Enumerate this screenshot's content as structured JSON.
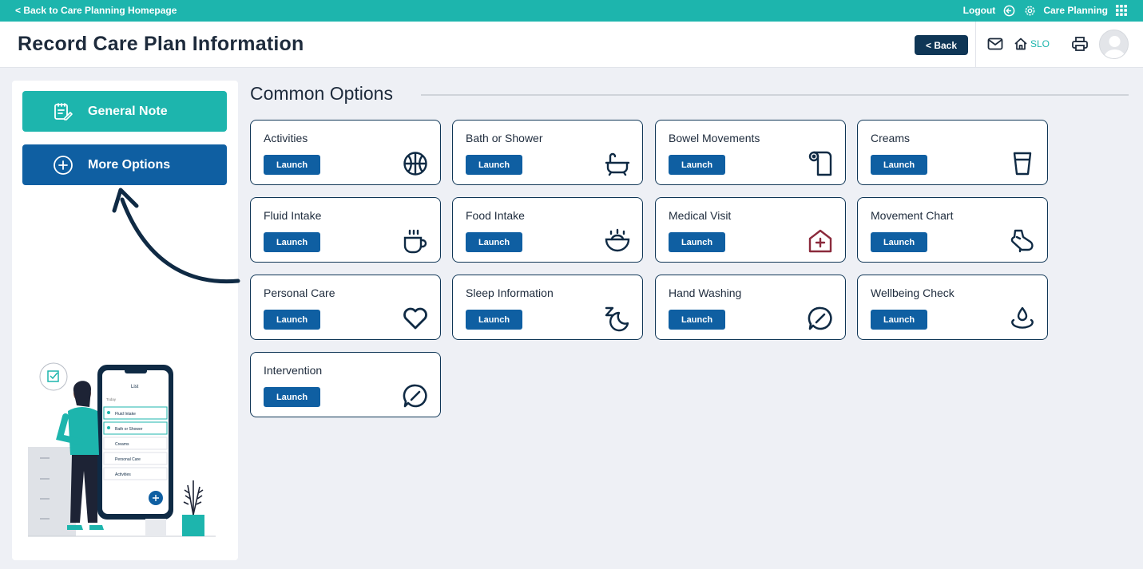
{
  "topbar": {
    "back_link": "< Back to Care Planning Homepage",
    "logout": "Logout",
    "app_name": "Care Planning"
  },
  "header": {
    "title": "Record Care Plan Information",
    "back_button": "< Back",
    "home_label": "SLO"
  },
  "sidebar": {
    "general_note": "General Note",
    "more_options": "More Options"
  },
  "illustration": {
    "phone_title": "List",
    "phone_today": "Today",
    "phone_items": [
      "Fluid Intake",
      "Bath or Shower",
      "Creams",
      "Personal Care",
      "Activities"
    ]
  },
  "common_options": {
    "title": "Common Options",
    "launch_label": "Launch",
    "cards": [
      {
        "name": "Activities",
        "icon": "ball-icon"
      },
      {
        "name": "Bath or Shower",
        "icon": "bathtub-icon"
      },
      {
        "name": "Bowel Movements",
        "icon": "toilet-roll-icon"
      },
      {
        "name": "Creams",
        "icon": "cup-icon"
      },
      {
        "name": "Fluid Intake",
        "icon": "mug-icon"
      },
      {
        "name": "Food Intake",
        "icon": "bowl-icon"
      },
      {
        "name": "Medical Visit",
        "icon": "hospital-icon"
      },
      {
        "name": "Movement Chart",
        "icon": "shoe-icon"
      },
      {
        "name": "Personal Care",
        "icon": "heart-icon"
      },
      {
        "name": "Sleep Information",
        "icon": "sleep-icon"
      },
      {
        "name": "Hand Washing",
        "icon": "soap-icon"
      },
      {
        "name": "Wellbeing Check",
        "icon": "water-drop-icon"
      },
      {
        "name": "Intervention",
        "icon": "intervention-icon"
      }
    ]
  },
  "colors": {
    "teal": "#1db5ad",
    "navy": "#0f3656",
    "blue": "#0f5fa2",
    "medical_red": "#8b2a3c"
  }
}
